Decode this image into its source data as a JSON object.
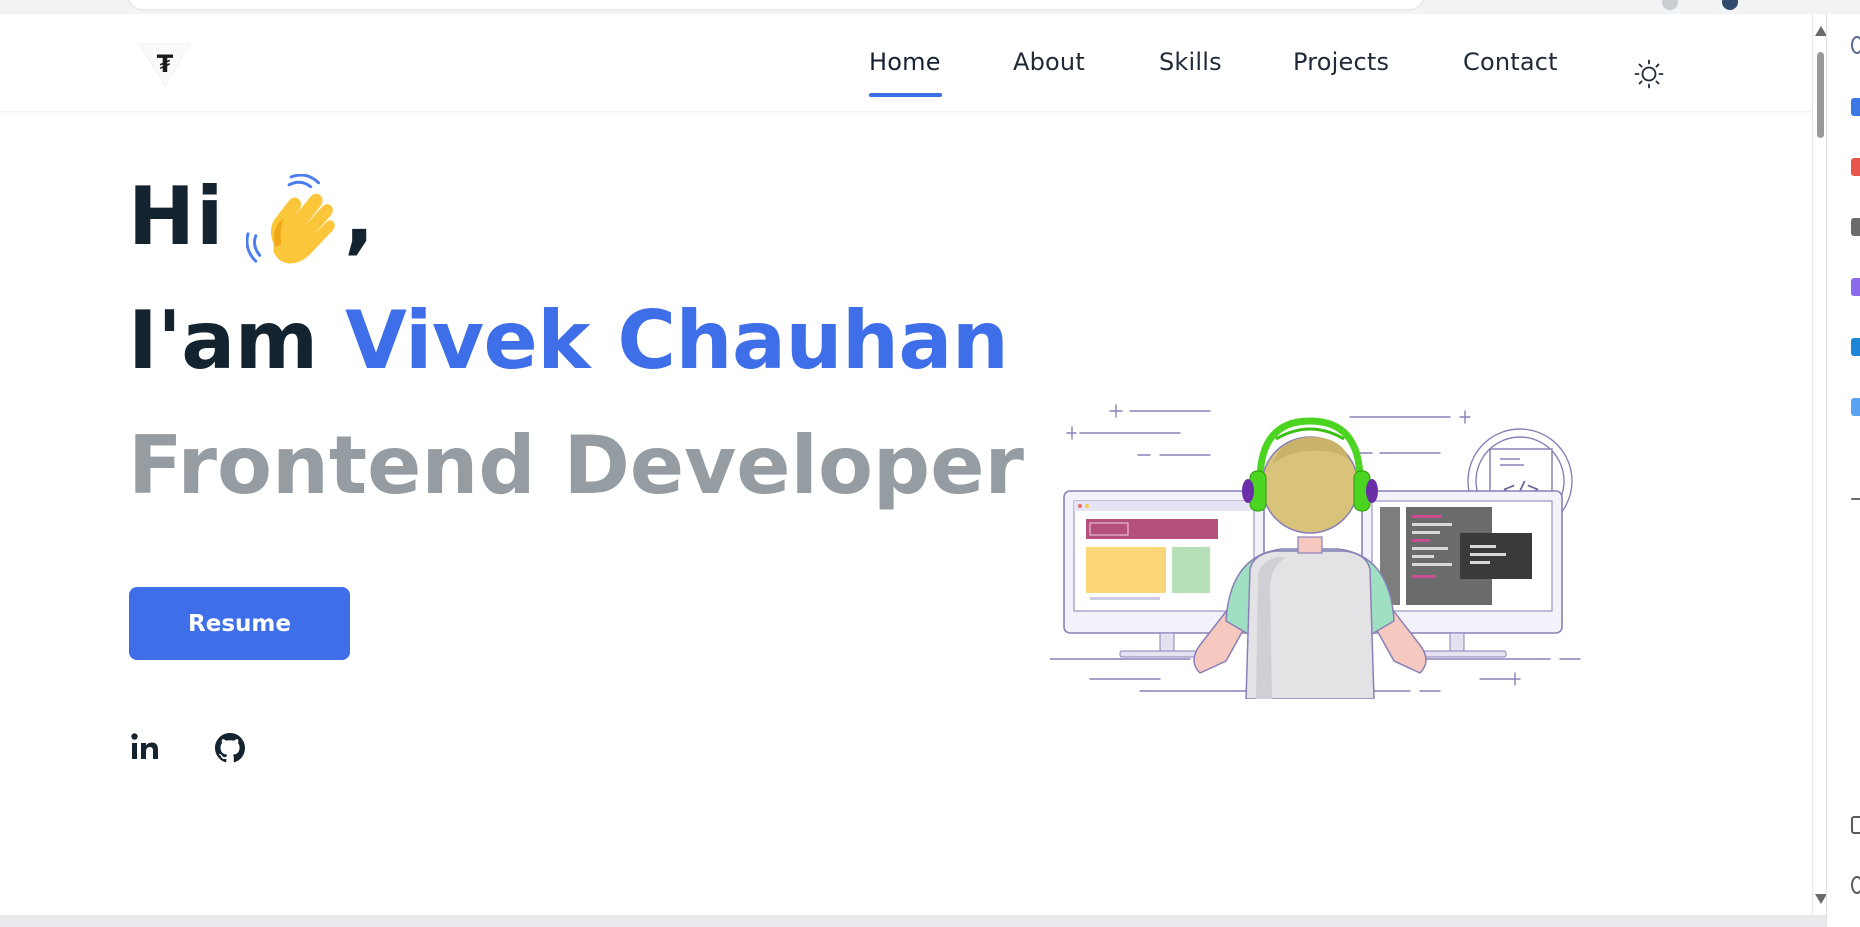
{
  "nav": {
    "links": [
      "Home",
      "About",
      "Skills",
      "Projects",
      "Contact"
    ],
    "active": "Home",
    "theme_icon": "sun-icon",
    "logo_icon": "logo-icon"
  },
  "hero": {
    "greeting": "Hi",
    "greeting_emoji": "waving-hand-icon",
    "comma": ",",
    "intro_prefix": "I'am ",
    "name": "Vivek Chauhan",
    "role": "Frontend Developer",
    "resume_label": "Resume"
  },
  "social": {
    "icons": [
      "linkedin-icon",
      "github-icon"
    ]
  },
  "colors": {
    "accent": "#3f6fe8",
    "heading": "#13232f",
    "muted": "#959ca2",
    "background": "#ffffff"
  }
}
